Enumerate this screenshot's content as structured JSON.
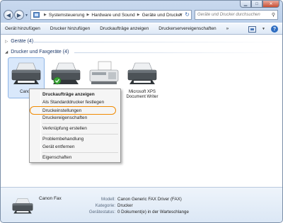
{
  "window": {
    "controls": {
      "minimize": "▁",
      "maximize": "□",
      "close": "✕"
    }
  },
  "address": {
    "crumbs": [
      "Systemsteuerung",
      "Hardware und Sound",
      "Geräte und Drucker"
    ],
    "search_placeholder": "Geräte und Drucker durchsuchen"
  },
  "toolbar": {
    "items": [
      "Gerät hinzufügen",
      "Drucker hinzufügen",
      "Druckaufträge anzeigen",
      "Druckerservereigenschaften"
    ],
    "more": "»"
  },
  "groups": {
    "devices": "Geräte (4)",
    "printers": "Drucker und Faxgeräte (4)"
  },
  "printers": [
    {
      "label": "Canon",
      "icon": "fax-printer-icon"
    },
    {
      "label": "",
      "icon": "default-printer-icon"
    },
    {
      "label": "",
      "icon": "fax-icon"
    },
    {
      "label": "Microsoft XPS Document Writer",
      "icon": "printer-icon"
    }
  ],
  "context_menu": {
    "items": [
      {
        "label": "Druckaufträge anzeigen",
        "bold": true
      },
      {
        "label": "Als Standarddrucker festlegen"
      },
      {
        "label": "Druckeinstellungen",
        "highlighted": true
      },
      {
        "label": "Druckereigenschaften"
      },
      {
        "label": "Verknüpfung erstellen"
      },
      {
        "label": "Problembehandlung"
      },
      {
        "label": "Gerät entfernen"
      },
      {
        "label": "Eigenschaften"
      }
    ],
    "highlight_color": "#f08a00"
  },
  "details": {
    "name": "Canon Fax",
    "keys": [
      "Modell:",
      "Kategorie:",
      "Gerätestatus:"
    ],
    "values": [
      "Canon Generic FAX Driver (FAX)",
      "Drucker",
      "0 Dokument(e) in der Warteschlange"
    ]
  }
}
